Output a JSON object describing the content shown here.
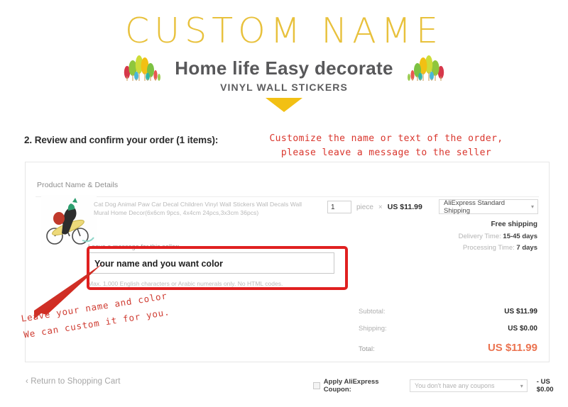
{
  "banner": {
    "brand_title": "CUSTOM NAME",
    "tagline": "Home life  Easy decorate",
    "sub_title": "VINYL WALL STICKERS",
    "left_trees_icon": "trees-icon",
    "right_trees_icon": "trees-icon",
    "arrow_icon": "triangle-down-icon",
    "brand_color": "#e8c13c",
    "arrow_color": "#f2c014"
  },
  "order": {
    "heading": "2. Review and confirm your order (1 items):",
    "annotation_top": "Customize the name or text of the order,\nplease leave a message to the seller",
    "annotation_color": "#d9352c",
    "card_label": "Product Name & Details",
    "product": {
      "image_icon": "cyclist-wall-sticker-image",
      "title": "Cat Dog Animal Paw Car Decal Children Vinyl Wall Stickers Wall Decals Wall Mural Home Decor(6x6cm 9pcs, 4x4cm 24pcs,3x3cm 36pcs)",
      "quantity": "1",
      "unit": "piece",
      "multiply": "×",
      "unit_price": "US $11.99"
    },
    "shipping": {
      "method": "AliExpress Standard Shipping",
      "free_label": "Free shipping",
      "delivery_time_label": "Delivery Time:",
      "delivery_time_value": "15-45 days",
      "processing_time_label": "Processing Time:",
      "processing_time_value": "7 days"
    },
    "message": {
      "label": "Leave a message for this seller:",
      "value": "Your name and you want color",
      "placeholder": "Your name and you want color",
      "hint": "Max. 1,000 English characters or Arabic numerals only. No HTML codes.",
      "highlight_color": "#e02020"
    },
    "totals": [
      {
        "key": "Subtotal:",
        "value": "US $11.99"
      },
      {
        "key": "Shipping:",
        "value": "US $0.00"
      },
      {
        "key": "Total:",
        "value": "US $11.99"
      }
    ],
    "total_color": "#eb7350",
    "annotation_bottom": "Leave your name and color\nWe can custom it for you.",
    "annotation_bottom_color": "#cf3c32",
    "arrow_icon": "red-arrow-pointer-icon"
  },
  "footer": {
    "return_link": "‹ Return to Shopping Cart",
    "coupon_label": "Apply AliExpress Coupon:",
    "coupon_placeholder": "You don't have any coupons",
    "coupon_amount": "- US $0.00",
    "checkbox_icon": "checkbox-unchecked-icon",
    "caret_icon": "chevron-down-icon"
  }
}
